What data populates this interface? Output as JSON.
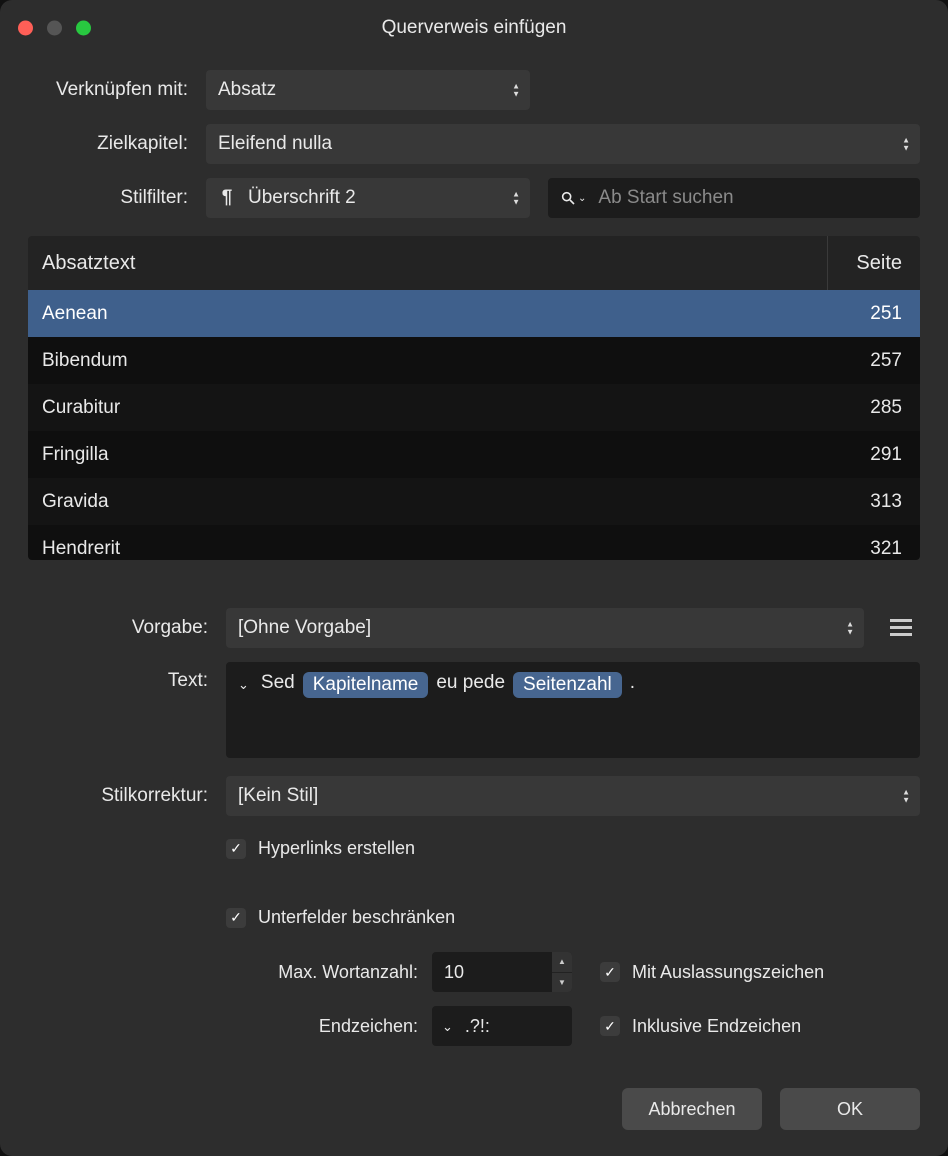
{
  "window": {
    "title": "Querverweis einfügen"
  },
  "link_with": {
    "label": "Verknüpfen mit:",
    "value": "Absatz"
  },
  "chapter": {
    "label": "Zielkapitel:",
    "value": "Eleifend nulla"
  },
  "style_filter": {
    "label": "Stilfilter:",
    "value": "Überschrift 2",
    "search_placeholder": "Ab Start suchen"
  },
  "table": {
    "headers": {
      "text": "Absatztext",
      "page": "Seite"
    },
    "rows": [
      {
        "text": "Aenean",
        "page": "251",
        "selected": true
      },
      {
        "text": "Bibendum",
        "page": "257"
      },
      {
        "text": "Curabitur",
        "page": "285"
      },
      {
        "text": "Fringilla",
        "page": "291"
      },
      {
        "text": "Gravida",
        "page": "313"
      },
      {
        "text": "Hendrerit",
        "page": "321"
      }
    ]
  },
  "preset": {
    "label": "Vorgabe:",
    "value": "[Ohne Vorgabe]"
  },
  "text": {
    "label": "Text:",
    "parts": {
      "before": "Sed",
      "pill1": "Kapitelname",
      "mid": "eu pede",
      "pill2": "Seitenzahl",
      "after": "."
    }
  },
  "style_correct": {
    "label": "Stilkorrektur:",
    "value": "[Kein Stil]"
  },
  "checks": {
    "hyperlinks": "Hyperlinks erstellen",
    "limit_sub": "Unterfelder beschränken",
    "max_words_label": "Max. Wortanzahl:",
    "max_words_value": "10",
    "ellipsis": "Mit Auslassungszeichen",
    "endchars_label": "Endzeichen:",
    "endchars_value": ".?!:",
    "incl_end": "Inklusive Endzeichen"
  },
  "buttons": {
    "cancel": "Abbrechen",
    "ok": "OK"
  }
}
